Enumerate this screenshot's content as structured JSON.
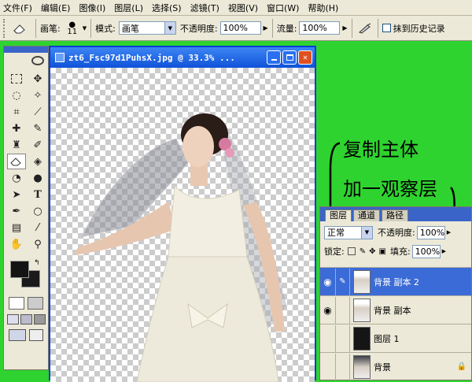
{
  "menu": [
    "文件(F)",
    "编辑(E)",
    "图像(I)",
    "图层(L)",
    "选择(S)",
    "滤镜(T)",
    "视图(V)",
    "窗口(W)",
    "帮助(H)"
  ],
  "options": {
    "brush_label": "画笔:",
    "brush_size": "11",
    "mode_label": "模式:",
    "mode_value": "画笔",
    "opacity_label": "不透明度:",
    "opacity_value": "100%",
    "flow_label": "流量:",
    "flow_value": "100%",
    "history_label": "抹到历史记录"
  },
  "document": {
    "title": "zt6_Fsc97d1PuhsX.jpg @ 33.3% ..."
  },
  "annotations": {
    "line1": "复制主体",
    "line2": "加一观察层"
  },
  "layers_panel": {
    "tabs": [
      "图层",
      "通道",
      "路径"
    ],
    "blend_mode": "正常",
    "opacity_label": "不透明度:",
    "opacity_value": "100%",
    "lock_label": "锁定:",
    "fill_label": "填充:",
    "fill_value": "100%",
    "layers": [
      {
        "name": "背景 副本 2",
        "selected": true,
        "visible": true
      },
      {
        "name": "背景 副本",
        "selected": false,
        "visible": true
      },
      {
        "name": "图层 1",
        "selected": false,
        "visible": false
      },
      {
        "name": "背景",
        "selected": false,
        "visible": false
      }
    ]
  },
  "colors": {
    "desktop": "#2fd32f",
    "titlebar": "#1052d8",
    "selected_layer": "#3b6bd6"
  }
}
